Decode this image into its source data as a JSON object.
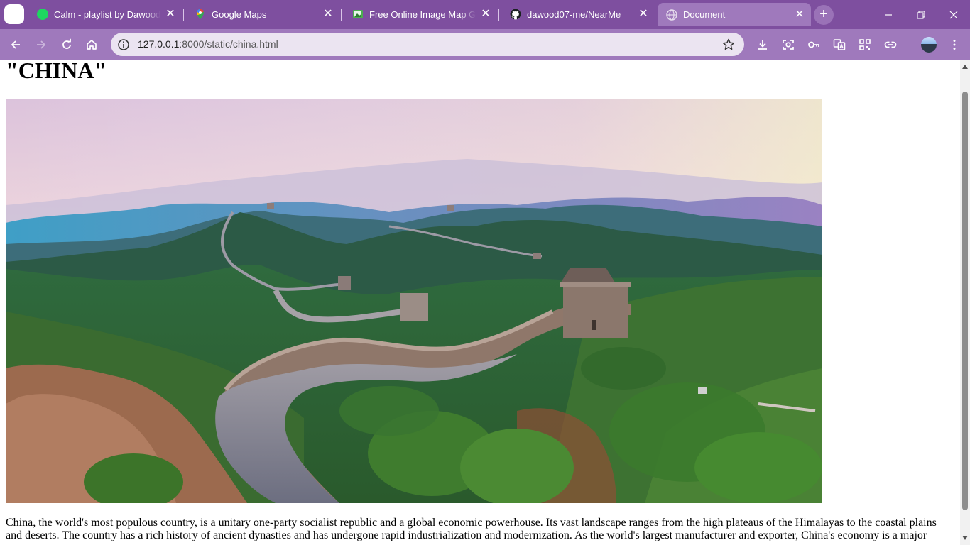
{
  "tabs": [
    {
      "title": "Calm - playlist by Dawood07",
      "favicon": "spotify-icon"
    },
    {
      "title": "Google Maps",
      "favicon": "google-maps-icon"
    },
    {
      "title": "Free Online Image Map Generator",
      "favicon": "image-map-generator-icon"
    },
    {
      "title": "dawood07-me/NearMe",
      "favicon": "github-icon"
    },
    {
      "title": "Document",
      "favicon": "globe-icon",
      "active": true
    }
  ],
  "address_bar": {
    "host": "127.0.0.1",
    "rest": ":8000/static/china.html"
  },
  "page": {
    "title": "\"CHINA\"",
    "image_description_icon": "great-wall-photo",
    "paragraph": "China, the world's most populous country, is a unitary one-party socialist republic and a global economic powerhouse. Its vast landscape ranges from the high plateaus of the Himalayas to the coastal plains and deserts. The country has a rich history of ancient dynasties and has undergone rapid industrialization and modernization. As the world's largest manufacturer and exporter, China's economy is a major"
  },
  "colors": {
    "tabstrip": "#7e4f9f",
    "toolbar": "#9f79bc",
    "omnibox": "#ebe4f1"
  }
}
